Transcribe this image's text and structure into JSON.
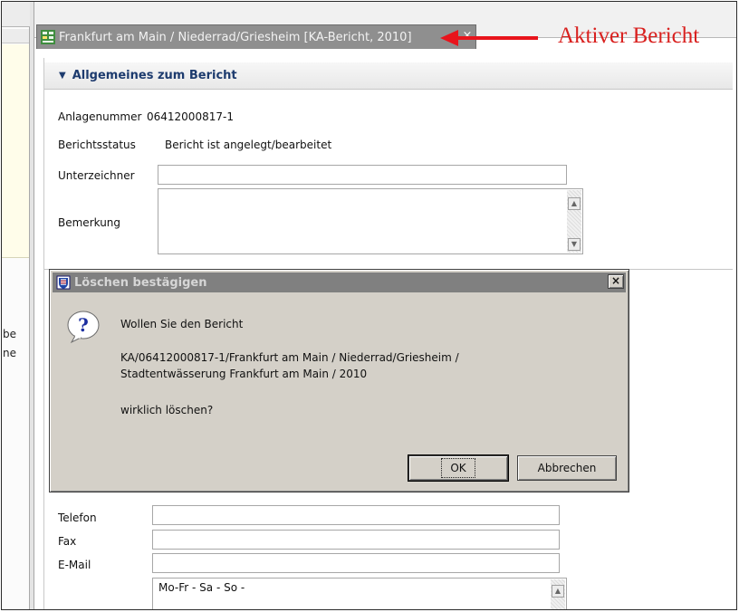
{
  "editor_tab": {
    "title": "Frankfurt am Main / Niederrad/Griesheim [KA-Bericht, 2010]",
    "close_label": "×"
  },
  "annotation": {
    "text": "Aktiver Bericht",
    "color": "#d9201e"
  },
  "left_panel": {
    "fragments": [
      "be",
      "ne"
    ]
  },
  "section": {
    "title": "Allgemeines zum Bericht"
  },
  "form": {
    "anlagenummer_label": "Anlagenummer",
    "anlagenummer_value": "06412000817-1",
    "berichtsstatus_label": "Berichtsstatus",
    "berichtsstatus_value": "Bericht ist angelegt/bearbeitet",
    "unterzeichner_label": "Unterzeichner",
    "unterzeichner_value": "",
    "bemerkung_label": "Bemerkung",
    "bemerkung_value": "",
    "telefon_label": "Telefon",
    "telefon_value": "",
    "fax_label": "Fax",
    "fax_value": "",
    "email_label": "E-Mail",
    "email_value": "",
    "zeiten_value": "Mo-Fr - Sa - So -"
  },
  "dialog": {
    "title": "Löschen bestägigen",
    "close_label": "×",
    "line1": "Wollen Sie den Bericht",
    "line2": "KA/06412000817-1/Frankfurt am Main / Niederrad/Griesheim /",
    "line3": "Stadtentwässerung Frankfurt am Main / 2010",
    "line4": "wirklich löschen?",
    "ok_label": "OK",
    "cancel_label": "Abbrechen"
  },
  "colors": {
    "tab_active": "#8f8f8f",
    "section_title": "#1d3b6e",
    "dialog_bg": "#d4d0c8",
    "dialog_title_inactive": "#808080"
  }
}
